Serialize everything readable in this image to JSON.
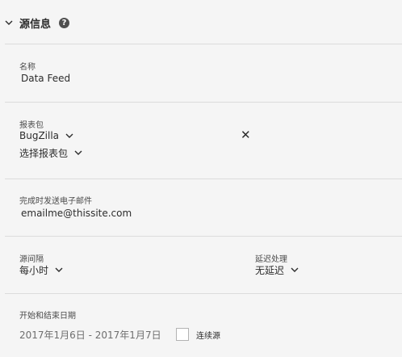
{
  "section": {
    "title": "源信息",
    "help_glyph": "?"
  },
  "name_field": {
    "label": "名称",
    "value": "Data Feed"
  },
  "report_suite": {
    "label": "报表包",
    "selected": "BugZilla",
    "select_label": "选择报表包",
    "remove_glyph": "✕"
  },
  "email": {
    "label": "完成时发送电子邮件",
    "value": "emailme@thissite.com"
  },
  "interval": {
    "label": "源间隔",
    "value": "每小时"
  },
  "delay": {
    "label": "延迟处理",
    "value": "无延迟"
  },
  "dates": {
    "label": "开始和结束日期",
    "range": "2017年1月6日 - 2017年1月7日",
    "continuous_label": "连续源"
  },
  "icons": [
    "chevron-down-icon",
    "help-icon",
    "close-icon"
  ]
}
